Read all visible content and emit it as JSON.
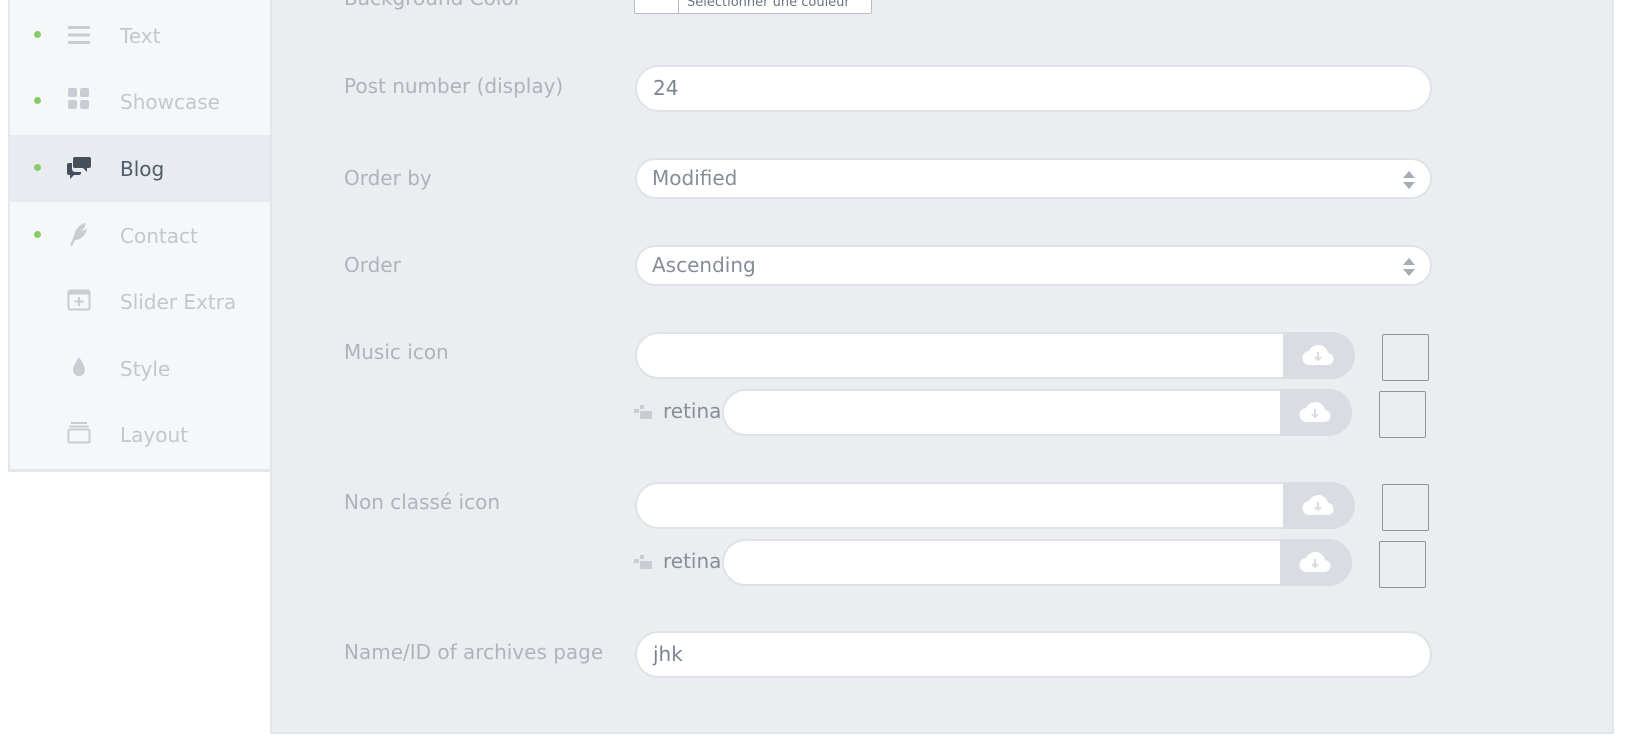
{
  "sidebar": {
    "items": [
      {
        "label": "Text",
        "icon": "menu-lines-icon",
        "dot": true,
        "active": false
      },
      {
        "label": "Showcase",
        "icon": "grid-icon",
        "dot": true,
        "active": false
      },
      {
        "label": "Blog",
        "icon": "chat-bubbles-icon",
        "dot": true,
        "active": true
      },
      {
        "label": "Contact",
        "icon": "feather-icon",
        "dot": true,
        "active": false
      },
      {
        "label": "Slider Extra",
        "icon": "add-window-icon",
        "dot": false,
        "active": false
      },
      {
        "label": "Style",
        "icon": "drop-icon",
        "dot": false,
        "active": false
      },
      {
        "label": "Layout",
        "icon": "layers-icon",
        "dot": false,
        "active": false
      }
    ]
  },
  "form": {
    "background_color": {
      "label": "Background Color",
      "button_text": "Sélectionner une couleur"
    },
    "post_number": {
      "label": "Post number (display)",
      "value": "24"
    },
    "order_by": {
      "label": "Order by",
      "value": "Modified"
    },
    "order": {
      "label": "Order",
      "value": "Ascending"
    },
    "music_icon": {
      "label": "Music icon",
      "value": "",
      "retina_label": "retina",
      "retina_value": ""
    },
    "non_classe_icon": {
      "label": "Non classé icon",
      "value": "",
      "retina_label": "retina",
      "retina_value": ""
    },
    "archives_page": {
      "label": "Name/ID of archives page",
      "value": "jhk"
    }
  },
  "colors": {
    "accent_dot": "#88cc6a",
    "panel_bg": "#ebedf1",
    "active_item_bg": "#e8ebef"
  }
}
